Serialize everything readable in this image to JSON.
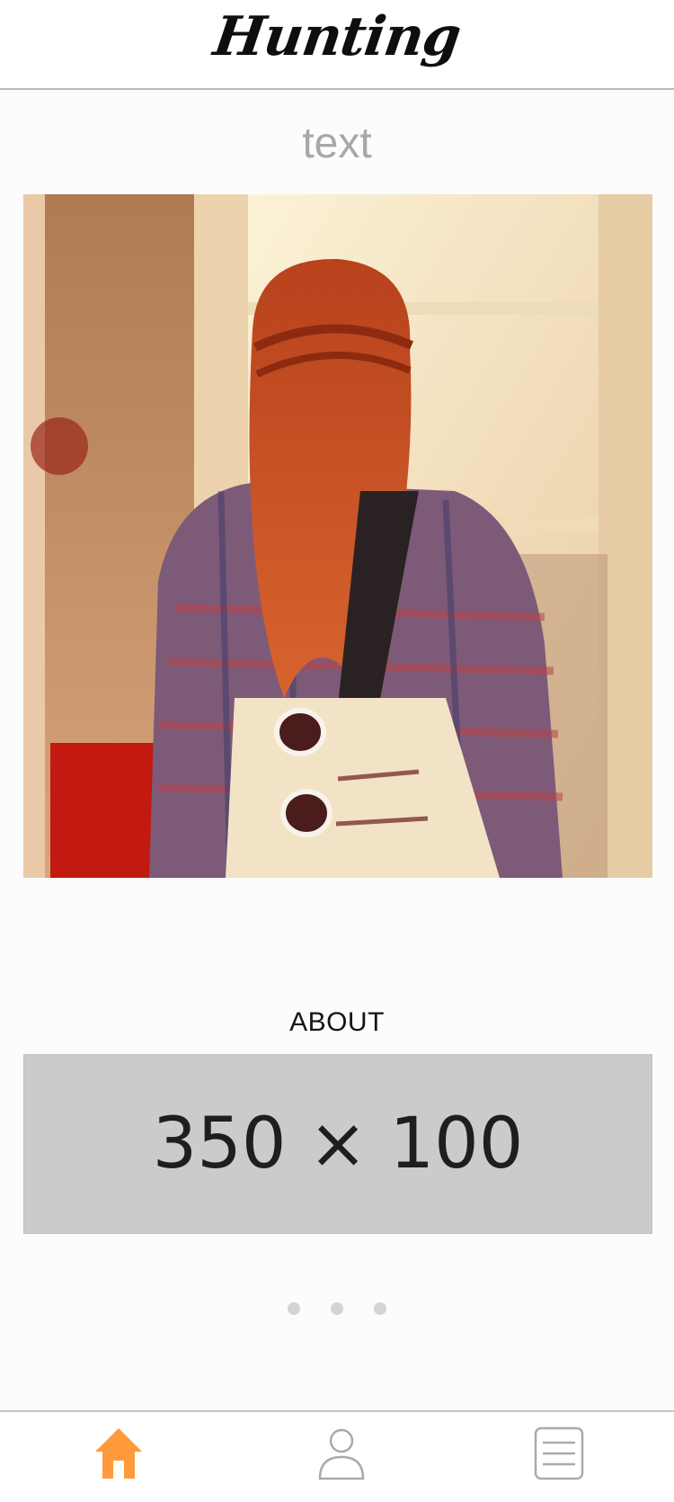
{
  "app": {
    "logo_text": "Hunting"
  },
  "post": {
    "title": "text"
  },
  "about": {
    "heading": "ABOUT",
    "placeholder_text": "350 × 100"
  },
  "pagination": {
    "pages": 3
  },
  "tab_bar": {
    "tabs": [
      {
        "icon": "home-icon",
        "active": true
      },
      {
        "icon": "person-icon",
        "active": false
      },
      {
        "icon": "menu-list-icon",
        "active": false
      }
    ],
    "active_color": "#ff9a3c",
    "inactive_color": "#aaaaaa"
  }
}
